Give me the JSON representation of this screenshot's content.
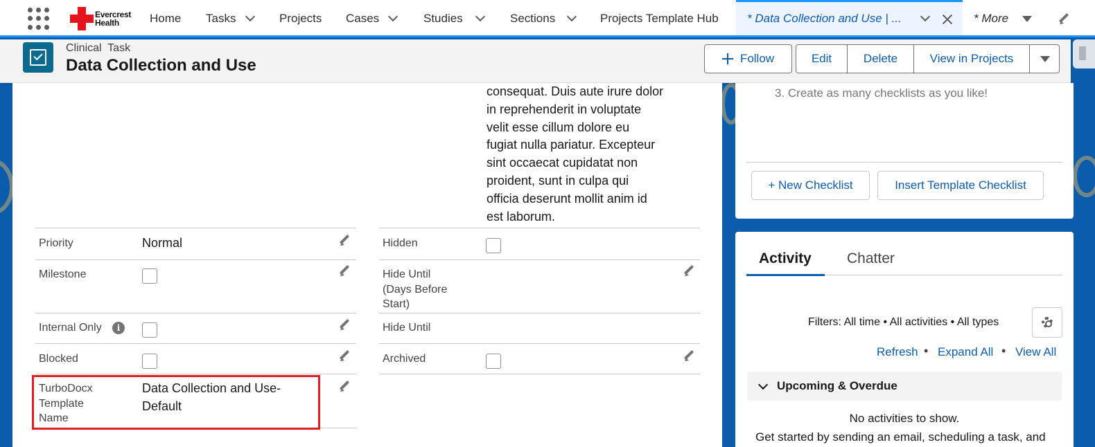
{
  "brand": {
    "logo_line1": "Evercrest",
    "logo_line2": "Health"
  },
  "nav": {
    "items": [
      {
        "label": "Home"
      },
      {
        "label": "Tasks"
      },
      {
        "label": "Projects"
      },
      {
        "label": "Cases"
      },
      {
        "label": "Studies"
      },
      {
        "label": "Sections"
      },
      {
        "label": "Projects Template Hub"
      }
    ],
    "active_tab": "* Data Collection and Use | ...",
    "more": "* More"
  },
  "record": {
    "type": "Clinical  Task",
    "title": "Data Collection and Use",
    "actions": {
      "follow": "Follow",
      "edit": "Edit",
      "delete": "Delete",
      "view": "View in Projects"
    }
  },
  "description": {
    "lines": [
      "consequat. Duis aute irure dolor",
      "in reprehenderit in voluptate",
      "velit esse cillum dolore eu",
      "fugiat nulla pariatur. Excepteur",
      "sint occaecat cupidatat non",
      "proident, sunt in culpa qui",
      "officia deserunt mollit anim id",
      "est laborum."
    ]
  },
  "fields": {
    "priority": {
      "label": "Priority",
      "value": "Normal"
    },
    "milestone": {
      "label": "Milestone"
    },
    "internal_only": {
      "label": "Internal Only",
      "info": "i"
    },
    "blocked": {
      "label": "Blocked"
    },
    "template_name": {
      "label_lines": [
        "TurboDocx",
        "Template",
        "Name"
      ],
      "value_lines": [
        "Data Collection and Use-",
        "Default"
      ]
    },
    "hidden": {
      "label": "Hidden"
    },
    "hide_until_days": {
      "label_lines": [
        "Hide Until",
        "(Days Before",
        "Start)"
      ]
    },
    "hide_until": {
      "label": "Hide Until"
    },
    "archived": {
      "label": "Archived"
    }
  },
  "checklist": {
    "item": "3. Create as many checklists as you like!",
    "new_button": "+ New Checklist",
    "insert_button": "Insert Template Checklist"
  },
  "activity": {
    "tabs": [
      "Activity",
      "Chatter"
    ],
    "filters": "Filters: All time • All activities • All types",
    "links": [
      "Refresh",
      "Expand All",
      "View All"
    ],
    "bullet": "•",
    "section": "Upcoming & Overdue",
    "empty": "No activities to show.",
    "hint": "Get started by sending an email, scheduling a task, and"
  },
  "colors": {
    "brand_blue": "#0b5cab",
    "highlight_red": "#e21d25",
    "accent": "#1b96ff"
  }
}
